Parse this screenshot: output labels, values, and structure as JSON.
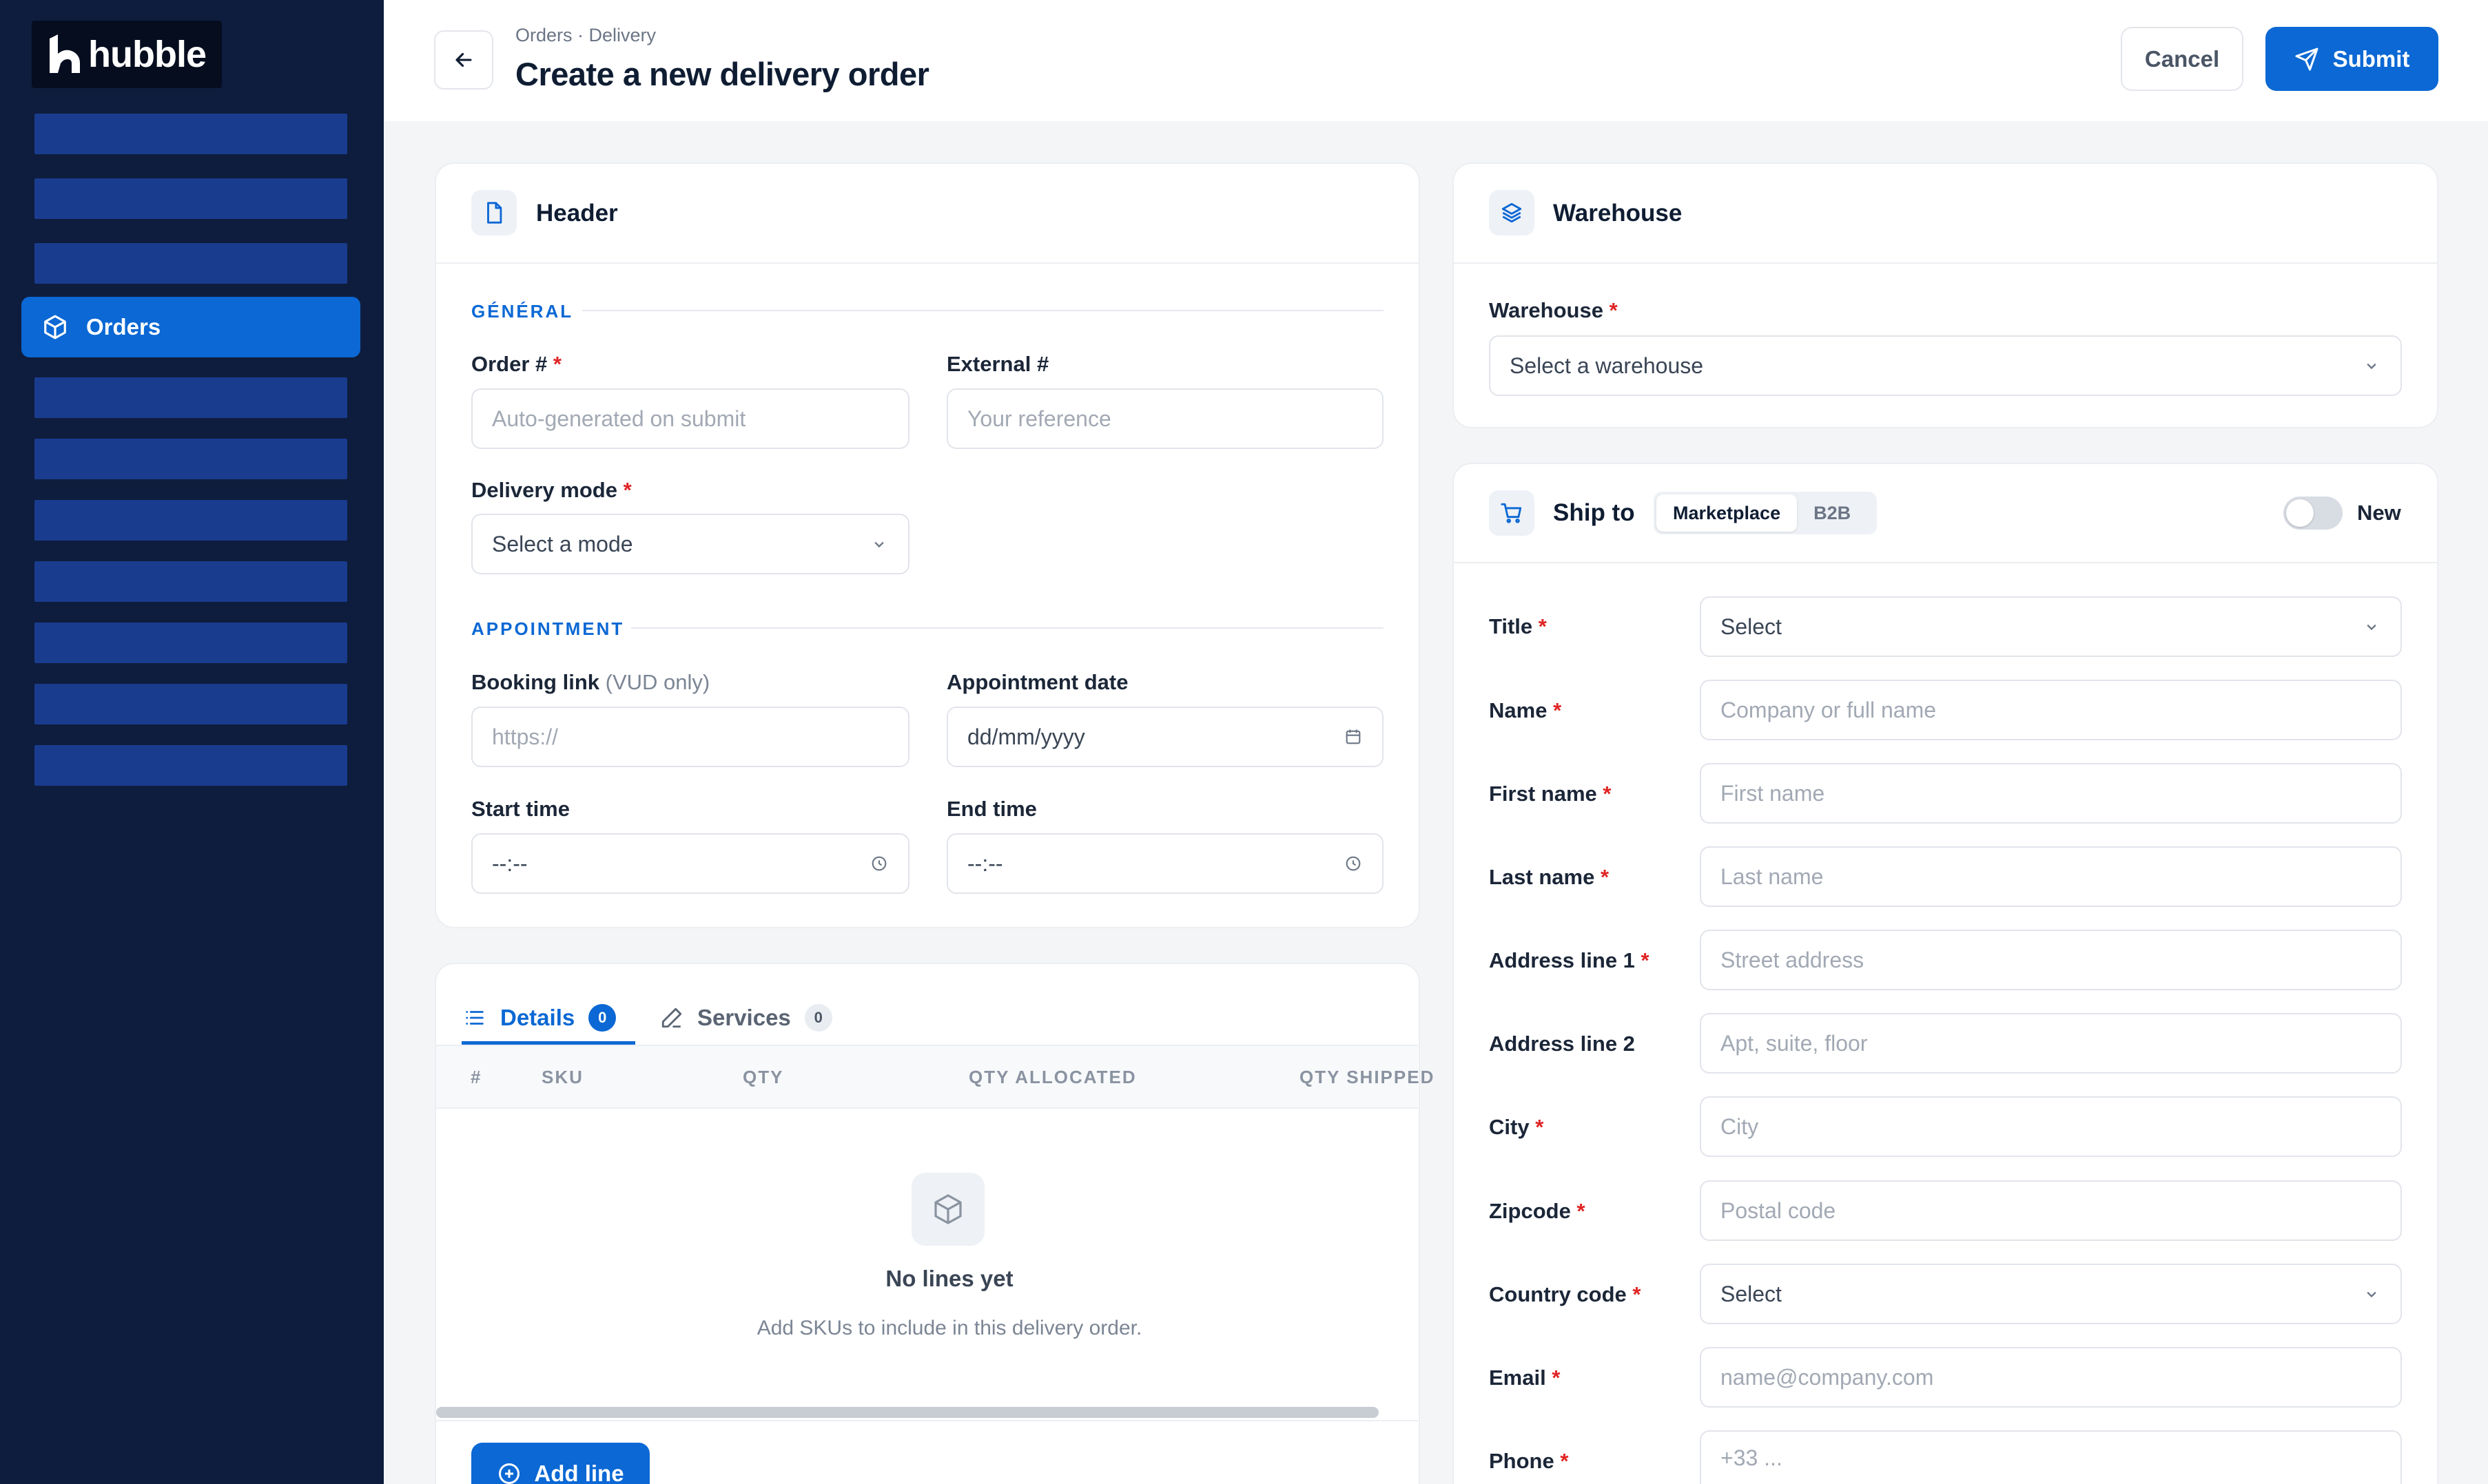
{
  "app": {
    "logo_text": "hubble",
    "nav_active_label": "Orders"
  },
  "header": {
    "breadcrumb": "Orders · Delivery",
    "title": "Create a new delivery order",
    "cancel_label": "Cancel",
    "submit_label": "Submit"
  },
  "header_card": {
    "title": "Header",
    "general_section": "GÉNÉRAL",
    "order_label": "Order #",
    "order_placeholder": "Auto-generated on submit",
    "external_label": "External #",
    "external_placeholder": "Your reference",
    "delivery_mode_label": "Delivery mode",
    "delivery_mode_value": "Select a mode",
    "appointment_section": "APPOINTMENT",
    "booking_label": "Booking link",
    "booking_hint": "(VUD only)",
    "booking_placeholder": "https://",
    "appointment_date_label": "Appointment date",
    "appointment_date_value": "dd/mm/yyyy",
    "start_time_label": "Start time",
    "start_time_value": "--:--",
    "end_time_label": "End time",
    "end_time_value": "--:--"
  },
  "lines_card": {
    "tab_details": "Details",
    "tab_details_count": "0",
    "tab_services": "Services",
    "tab_services_count": "0",
    "columns": [
      "#",
      "SKU",
      "QTY",
      "QTY ALLOCATED",
      "QTY SHIPPED"
    ],
    "empty_title": "No lines yet",
    "empty_subtitle": "Add SKUs to include in this delivery order.",
    "add_line_label": "Add line"
  },
  "warehouse_card": {
    "title": "Warehouse",
    "field_label": "Warehouse",
    "field_value": "Select a warehouse"
  },
  "ship_to_card": {
    "title": "Ship to",
    "seg_active": "Marketplace",
    "seg_inactive": "B2B",
    "toggle_label": "New",
    "fields": {
      "title_label": "Title",
      "title_value": "Select",
      "name_label": "Name",
      "name_placeholder": "Company or full name",
      "first_name_label": "First name",
      "first_name_placeholder": "First name",
      "last_name_label": "Last name",
      "last_name_placeholder": "Last name",
      "address1_label": "Address line 1",
      "address1_placeholder": "Street address",
      "address2_label": "Address line 2",
      "address2_placeholder": "Apt, suite, floor",
      "city_label": "City",
      "city_placeholder": "City",
      "zipcode_label": "Zipcode",
      "zipcode_placeholder": "Postal code",
      "country_label": "Country code",
      "country_value": "Select",
      "email_label": "Email",
      "email_placeholder": "name@company.com",
      "phone_label": "Phone",
      "phone_placeholder": "+33 ..."
    }
  },
  "colors": {
    "accent": "#0b68d4",
    "sidebar_bg": "#0e1d3d",
    "required": "#e02424"
  }
}
